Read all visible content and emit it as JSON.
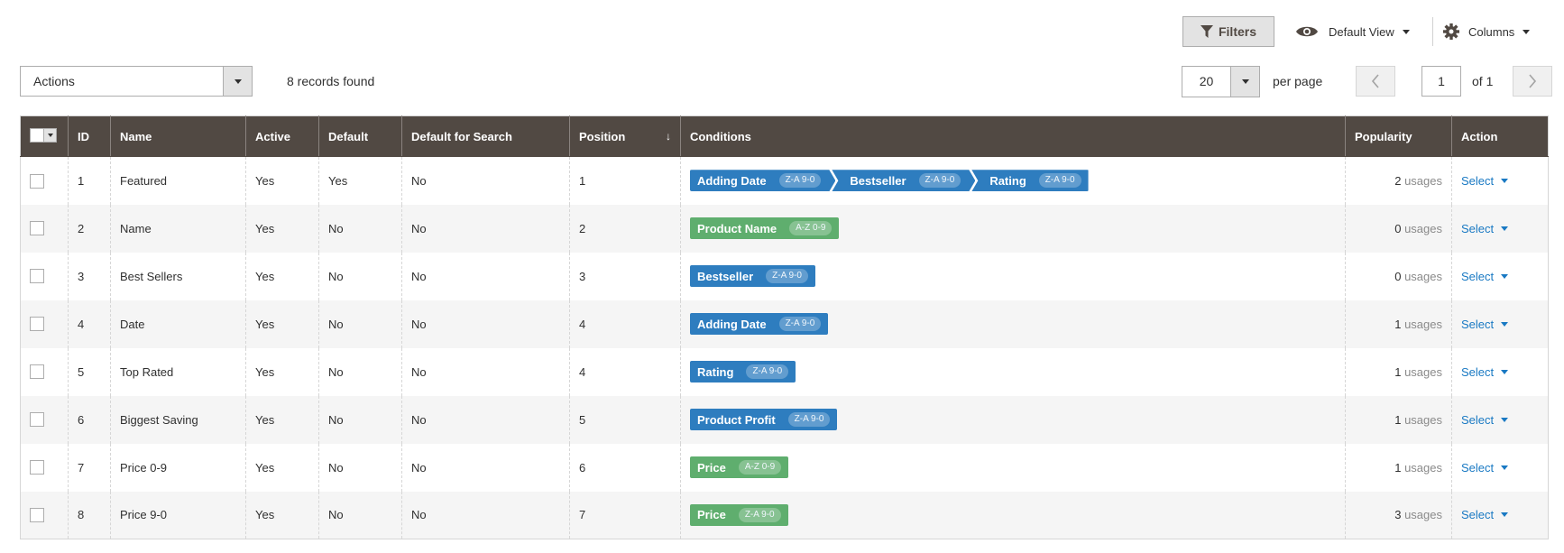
{
  "toolbar": {
    "filters_label": "Filters",
    "view_label": "Default View",
    "columns_label": "Columns",
    "icons": {
      "filters": "funnel-icon",
      "view": "eye-icon",
      "columns": "gear-icon"
    }
  },
  "actions": {
    "label": "Actions",
    "records_found": "8 records found"
  },
  "pagination": {
    "per_page": "20",
    "per_page_label": "per page",
    "current_page": "1",
    "of_label": "of 1",
    "prev_icon": "chevron-left-icon",
    "next_icon": "chevron-right-icon"
  },
  "table": {
    "headers": {
      "id": "ID",
      "name": "Name",
      "active": "Active",
      "default": "Default",
      "default_search": "Default for Search",
      "position": "Position",
      "position_sort": "↓",
      "conditions": "Conditions",
      "popularity": "Popularity",
      "action": "Action"
    },
    "usages_unit": "usages",
    "action_label": "Select",
    "rows": [
      {
        "id": "1",
        "name": "Featured",
        "active": "Yes",
        "default": "Yes",
        "default_search": "No",
        "position": "1",
        "popularity": "2",
        "conditions": [
          {
            "label": "Adding Date",
            "order": "Z-A 9-0",
            "color": "blue"
          },
          {
            "label": "Bestseller",
            "order": "Z-A 9-0",
            "color": "blue"
          },
          {
            "label": "Rating",
            "order": "Z-A 9-0",
            "color": "blue"
          }
        ]
      },
      {
        "id": "2",
        "name": "Name",
        "active": "Yes",
        "default": "No",
        "default_search": "No",
        "position": "2",
        "popularity": "0",
        "conditions": [
          {
            "label": "Product Name",
            "order": "A-Z 0-9",
            "color": "green"
          }
        ]
      },
      {
        "id": "3",
        "name": "Best Sellers",
        "active": "Yes",
        "default": "No",
        "default_search": "No",
        "position": "3",
        "popularity": "0",
        "conditions": [
          {
            "label": "Bestseller",
            "order": "Z-A 9-0",
            "color": "blue"
          }
        ]
      },
      {
        "id": "4",
        "name": "Date",
        "active": "Yes",
        "default": "No",
        "default_search": "No",
        "position": "4",
        "popularity": "1",
        "conditions": [
          {
            "label": "Adding Date",
            "order": "Z-A 9-0",
            "color": "blue"
          }
        ]
      },
      {
        "id": "5",
        "name": "Top Rated",
        "active": "Yes",
        "default": "No",
        "default_search": "No",
        "position": "4",
        "popularity": "1",
        "conditions": [
          {
            "label": "Rating",
            "order": "Z-A 9-0",
            "color": "blue"
          }
        ]
      },
      {
        "id": "6",
        "name": "Biggest Saving",
        "active": "Yes",
        "default": "No",
        "default_search": "No",
        "position": "5",
        "popularity": "1",
        "conditions": [
          {
            "label": "Product Profit",
            "order": "Z-A 9-0",
            "color": "blue"
          }
        ]
      },
      {
        "id": "7",
        "name": "Price 0-9",
        "active": "Yes",
        "default": "No",
        "default_search": "No",
        "position": "6",
        "popularity": "1",
        "conditions": [
          {
            "label": "Price",
            "order": "A-Z 0-9",
            "color": "green"
          }
        ]
      },
      {
        "id": "8",
        "name": "Price 9-0",
        "active": "Yes",
        "default": "No",
        "default_search": "No",
        "position": "7",
        "popularity": "3",
        "conditions": [
          {
            "label": "Price",
            "order": "Z-A 9-0",
            "color": "green"
          }
        ]
      }
    ]
  },
  "colors": {
    "header_bg": "#514943",
    "blue": "#2e7dbf",
    "green": "#5fae6e",
    "link": "#1979c3"
  }
}
